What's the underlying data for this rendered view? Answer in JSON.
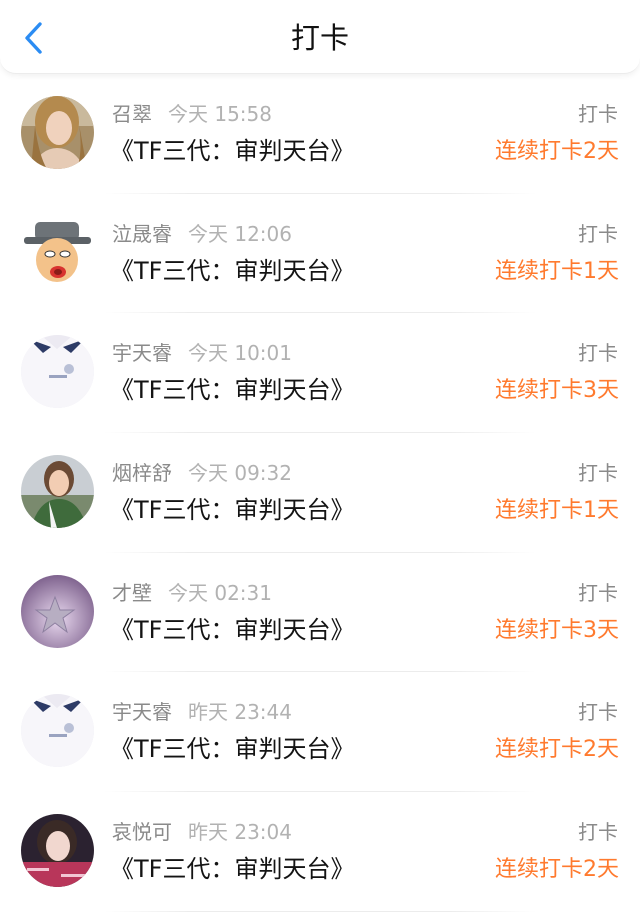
{
  "header": {
    "title": "打卡"
  },
  "theme": {
    "accent": "#2b8cf3",
    "streak_color": "#ff7a2e"
  },
  "rows": [
    {
      "user": "召翠",
      "time": "今天 15:58",
      "title": "《TF三代：审判天台》",
      "action": "打卡",
      "streak": "连续打卡2天",
      "avatar": "photo-woman-blonde"
    },
    {
      "user": "泣晟睿",
      "time": "今天 12:06",
      "title": "《TF三代：审判天台》",
      "action": "打卡",
      "streak": "连续打卡1天",
      "avatar": "cartoon-old-man-hat"
    },
    {
      "user": "宇天睿",
      "time": "今天 10:01",
      "title": "《TF三代：审判天台》",
      "action": "打卡",
      "streak": "连续打卡3天",
      "avatar": "photo-white-polo-shirt"
    },
    {
      "user": "烟梓舒",
      "time": "今天 09:32",
      "title": "《TF三代：审判天台》",
      "action": "打卡",
      "streak": "连续打卡1天",
      "avatar": "photo-woman-green-jacket"
    },
    {
      "user": "才壁",
      "time": "今天 02:31",
      "title": "《TF三代：审判天台》",
      "action": "打卡",
      "streak": "连续打卡3天",
      "avatar": "photo-purple-star"
    },
    {
      "user": "宇天睿",
      "time": "昨天 23:44",
      "title": "《TF三代：审判天台》",
      "action": "打卡",
      "streak": "连续打卡2天",
      "avatar": "photo-white-polo-shirt"
    },
    {
      "user": "哀悦可",
      "time": "昨天 23:04",
      "title": "《TF三代：审判天台》",
      "action": "打卡",
      "streak": "连续打卡2天",
      "avatar": "photo-girl-red-text"
    }
  ]
}
